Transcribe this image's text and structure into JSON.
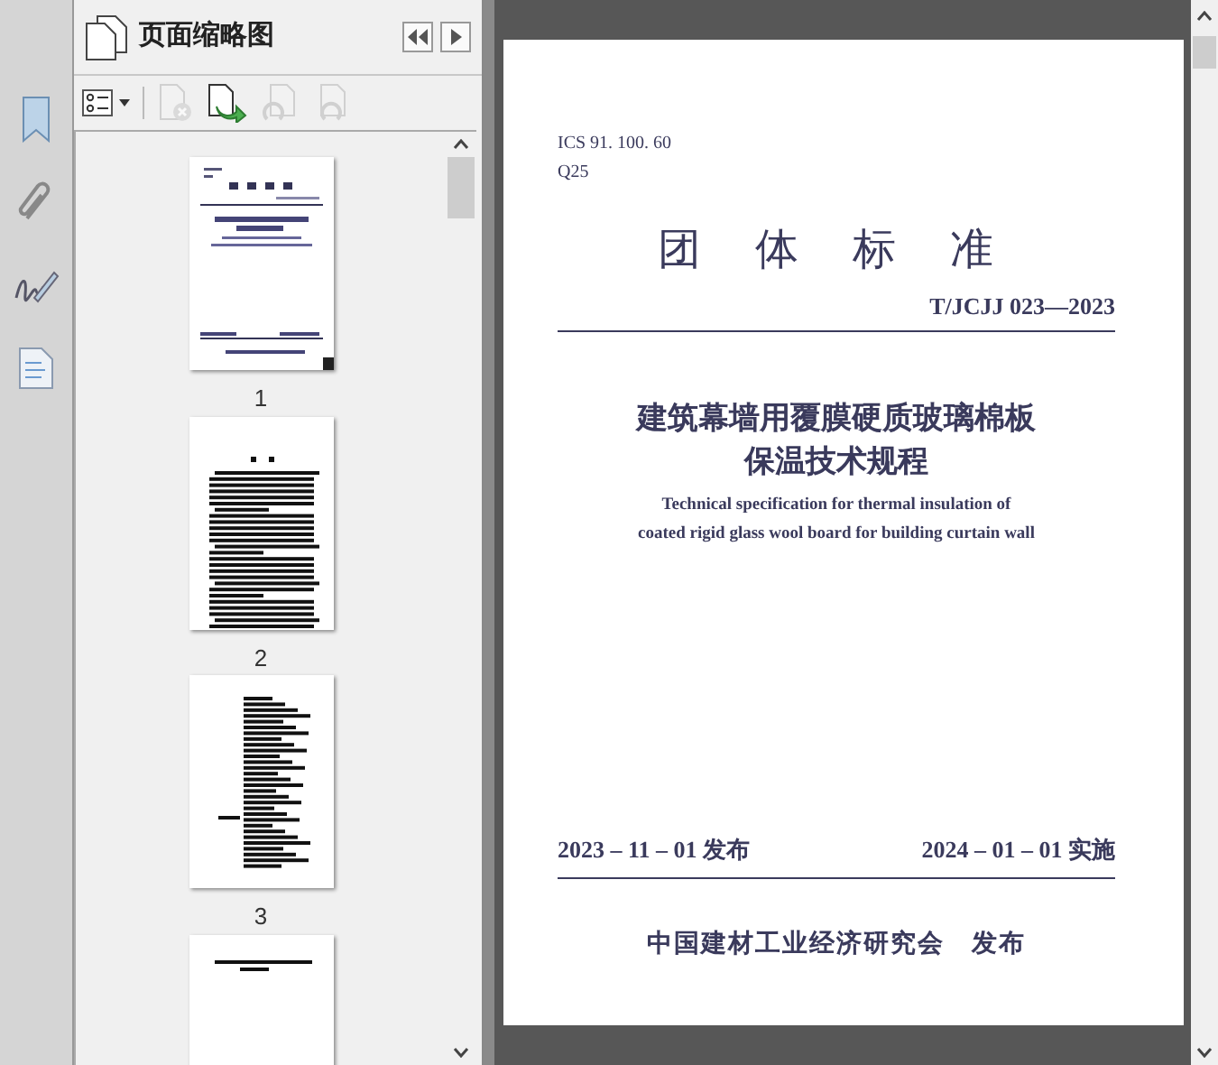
{
  "panel": {
    "title": "页面缩略图"
  },
  "side_tools": [
    {
      "kind": "bookmark"
    },
    {
      "kind": "attachment"
    },
    {
      "kind": "signature"
    },
    {
      "kind": "content"
    }
  ],
  "toolbar": [
    {
      "kind": "options",
      "disabled": false
    },
    {
      "kind": "delete",
      "disabled": true
    },
    {
      "kind": "insert",
      "disabled": false
    },
    {
      "kind": "undo",
      "disabled": true
    },
    {
      "kind": "redo",
      "disabled": true
    }
  ],
  "thumbnails": [
    {
      "label": "1",
      "selected": true,
      "kind": "cover"
    },
    {
      "label": "2",
      "selected": false,
      "kind": "text"
    },
    {
      "label": "3",
      "selected": false,
      "kind": "list"
    },
    {
      "kind": "short"
    }
  ],
  "document": {
    "ics": "ICS 91. 100. 60",
    "class_code": "Q25",
    "heading": "团 体 标 准",
    "standard_no": "T/JCJJ 023—2023",
    "title_lines": [
      "建筑幕墙用覆膜硬质玻璃棉板",
      "保温技术规程"
    ],
    "english_lines": [
      "Technical specification for thermal insulation of",
      "coated rigid glass wool board for building curtain wall"
    ],
    "issue_date": "2023 – 11 – 01 发布",
    "effective_date": "2024 – 01 – 01 实施",
    "publisher": "中国建材工业经济研究会　发布"
  }
}
